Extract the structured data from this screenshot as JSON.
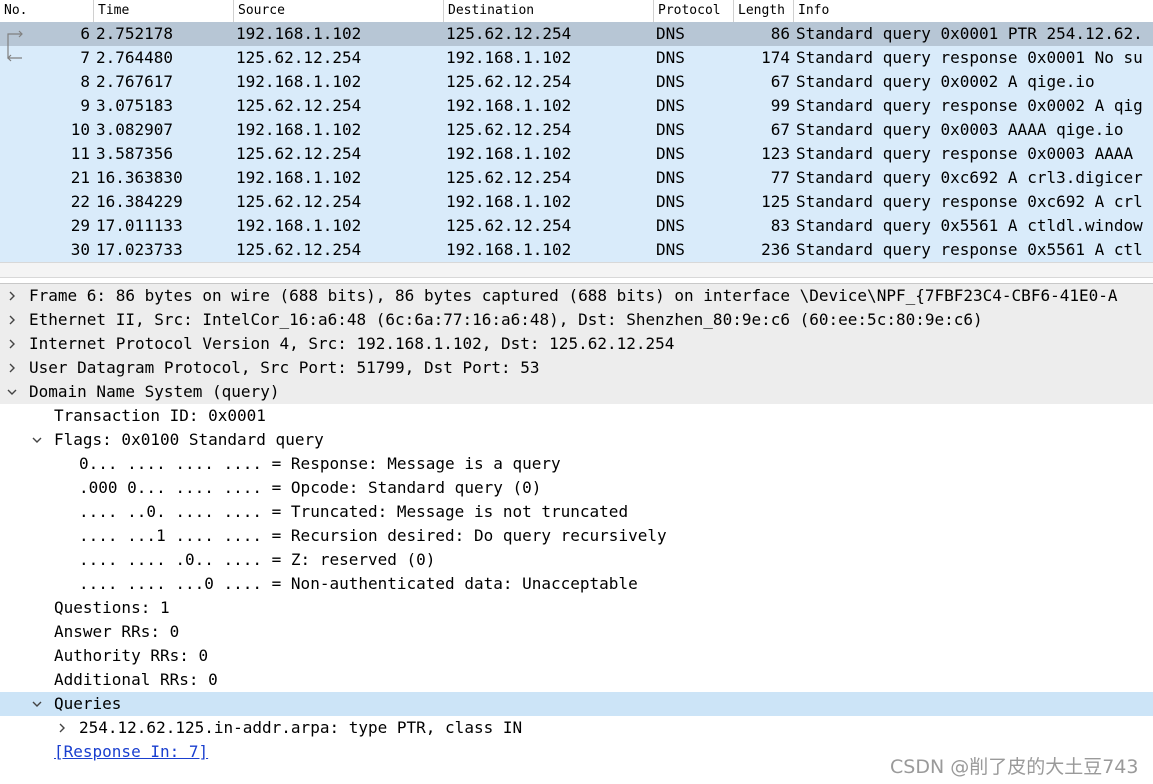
{
  "columns": [
    "No.",
    "Time",
    "Source",
    "Destination",
    "Protocol",
    "Length",
    "Info"
  ],
  "packets": [
    {
      "no": "6",
      "time": "2.752178",
      "src": "192.168.1.102",
      "dst": "125.62.12.254",
      "proto": "DNS",
      "len": "86",
      "info": "Standard query 0x0001 PTR 254.12.62."
    },
    {
      "no": "7",
      "time": "2.764480",
      "src": "125.62.12.254",
      "dst": "192.168.1.102",
      "proto": "DNS",
      "len": "174",
      "info": "Standard query response 0x0001 No su"
    },
    {
      "no": "8",
      "time": "2.767617",
      "src": "192.168.1.102",
      "dst": "125.62.12.254",
      "proto": "DNS",
      "len": "67",
      "info": "Standard query 0x0002 A qige.io"
    },
    {
      "no": "9",
      "time": "3.075183",
      "src": "125.62.12.254",
      "dst": "192.168.1.102",
      "proto": "DNS",
      "len": "99",
      "info": "Standard query response 0x0002 A qig"
    },
    {
      "no": "10",
      "time": "3.082907",
      "src": "192.168.1.102",
      "dst": "125.62.12.254",
      "proto": "DNS",
      "len": "67",
      "info": "Standard query 0x0003 AAAA qige.io"
    },
    {
      "no": "11",
      "time": "3.587356",
      "src": "125.62.12.254",
      "dst": "192.168.1.102",
      "proto": "DNS",
      "len": "123",
      "info": "Standard query response 0x0003 AAAA"
    },
    {
      "no": "21",
      "time": "16.363830",
      "src": "192.168.1.102",
      "dst": "125.62.12.254",
      "proto": "DNS",
      "len": "77",
      "info": "Standard query 0xc692 A crl3.digicer"
    },
    {
      "no": "22",
      "time": "16.384229",
      "src": "125.62.12.254",
      "dst": "192.168.1.102",
      "proto": "DNS",
      "len": "125",
      "info": "Standard query response 0xc692 A crl"
    },
    {
      "no": "29",
      "time": "17.011133",
      "src": "192.168.1.102",
      "dst": "125.62.12.254",
      "proto": "DNS",
      "len": "83",
      "info": "Standard query 0x5561 A ctldl.window"
    },
    {
      "no": "30",
      "time": "17.023733",
      "src": "125.62.12.254",
      "dst": "192.168.1.102",
      "proto": "DNS",
      "len": "236",
      "info": "Standard query response 0x5561 A ctl"
    }
  ],
  "details": [
    {
      "text": "Frame 6: 86 bytes on wire (688 bits), 86 bytes captured (688 bits) on interface \\Device\\NPF_{7FBF23C4-CBF6-41E0-A",
      "indent": 0,
      "arrow": "right",
      "style": "shaded"
    },
    {
      "text": "Ethernet II, Src: IntelCor_16:a6:48 (6c:6a:77:16:a6:48), Dst: Shenzhen_80:9e:c6 (60:ee:5c:80:9e:c6)",
      "indent": 0,
      "arrow": "right",
      "style": "shaded"
    },
    {
      "text": "Internet Protocol Version 4, Src: 192.168.1.102, Dst: 125.62.12.254",
      "indent": 0,
      "arrow": "right",
      "style": "shaded"
    },
    {
      "text": "User Datagram Protocol, Src Port: 51799, Dst Port: 53",
      "indent": 0,
      "arrow": "right",
      "style": "shaded"
    },
    {
      "text": "Domain Name System (query)",
      "indent": 0,
      "arrow": "down",
      "style": "shaded"
    },
    {
      "text": "Transaction ID: 0x0001",
      "indent": 1,
      "arrow": "",
      "style": ""
    },
    {
      "text": "Flags: 0x0100 Standard query",
      "indent": 1,
      "arrow": "down",
      "style": ""
    },
    {
      "text": "0... .... .... .... = Response: Message is a query",
      "indent": 2,
      "arrow": "",
      "style": ""
    },
    {
      "text": ".000 0... .... .... = Opcode: Standard query (0)",
      "indent": 2,
      "arrow": "",
      "style": ""
    },
    {
      "text": ".... ..0. .... .... = Truncated: Message is not truncated",
      "indent": 2,
      "arrow": "",
      "style": ""
    },
    {
      "text": ".... ...1 .... .... = Recursion desired: Do query recursively",
      "indent": 2,
      "arrow": "",
      "style": ""
    },
    {
      "text": ".... .... .0.. .... = Z: reserved (0)",
      "indent": 2,
      "arrow": "",
      "style": ""
    },
    {
      "text": ".... .... ...0 .... = Non-authenticated data: Unacceptable",
      "indent": 2,
      "arrow": "",
      "style": ""
    },
    {
      "text": "Questions: 1",
      "indent": 1,
      "arrow": "",
      "style": ""
    },
    {
      "text": "Answer RRs: 0",
      "indent": 1,
      "arrow": "",
      "style": ""
    },
    {
      "text": "Authority RRs: 0",
      "indent": 1,
      "arrow": "",
      "style": ""
    },
    {
      "text": "Additional RRs: 0",
      "indent": 1,
      "arrow": "",
      "style": ""
    },
    {
      "text": "Queries",
      "indent": 1,
      "arrow": "down",
      "style": "sel"
    },
    {
      "text": "254.12.62.125.in-addr.arpa: type PTR, class IN",
      "indent": 2,
      "arrow": "right",
      "style": ""
    },
    {
      "text": "[Response In: 7]",
      "indent": 1,
      "arrow": "",
      "style": "link"
    }
  ],
  "watermark": "CSDN @削了皮的大土豆743",
  "colors": {
    "list_bg": "#d9ebfa",
    "selected_row": "#b7c6d5",
    "shaded_row": "#ededed",
    "selected_detail": "#cce4f7",
    "link": "#1a3fcf"
  }
}
